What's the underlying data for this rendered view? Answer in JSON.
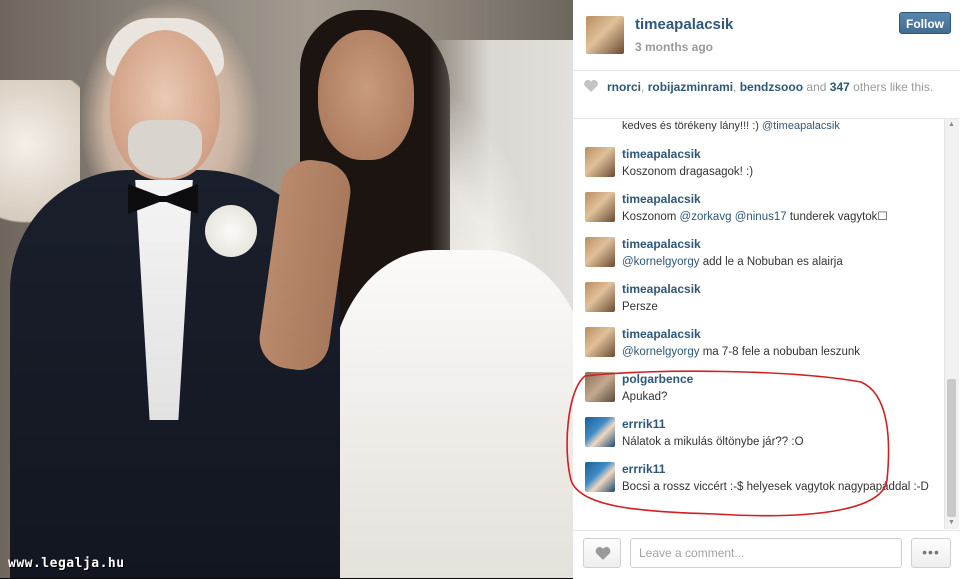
{
  "watermark": "www.legalja.hu",
  "post": {
    "username": "timeapalacsik",
    "time": "3 months ago",
    "follow_label": "Follow"
  },
  "likes": {
    "users": [
      "rnorci",
      "robijazminrami",
      "bendzsooo"
    ],
    "and": "and",
    "count": "347",
    "rest": "others like this."
  },
  "cut_comment": {
    "text": "kedves és törékeny lány!!! :)",
    "mention": "@timeapalacsik"
  },
  "comments": [
    {
      "user": "timeapalacsik",
      "parts": [
        {
          "t": "Koszonom dragasagok! :)"
        }
      ]
    },
    {
      "user": "timeapalacsik",
      "parts": [
        {
          "t": "Koszonom "
        },
        {
          "m": "@zorkavg"
        },
        {
          "t": " "
        },
        {
          "m": "@ninus17"
        },
        {
          "t": " tunderek vagytok☐"
        }
      ]
    },
    {
      "user": "timeapalacsik",
      "parts": [
        {
          "m": "@kornelgyorgy"
        },
        {
          "t": " add le a Nobuban es alairja"
        }
      ]
    },
    {
      "user": "timeapalacsik",
      "parts": [
        {
          "t": "Persze"
        }
      ]
    },
    {
      "user": "timeapalacsik",
      "parts": [
        {
          "m": "@kornelgyorgy"
        },
        {
          "t": " ma 7-8 fele a nobuban leszunk"
        }
      ]
    },
    {
      "user": "polgarbence",
      "parts": [
        {
          "t": "Apukad?"
        }
      ]
    },
    {
      "user": "errrik11",
      "parts": [
        {
          "t": "Nálatok a mikulás öltönybe jár?? :O"
        }
      ]
    },
    {
      "user": "errrik11",
      "parts": [
        {
          "t": "Bocsi a rossz viccért :-$ helyesek vagytok nagypapáddal :-D"
        }
      ]
    }
  ],
  "comment_box": {
    "placeholder": "Leave a comment...",
    "more_label": "•••"
  },
  "colors": {
    "link": "#2f5777",
    "follow_bg": "#3f6d94",
    "annotation": "#d21f1f"
  },
  "icons": [
    "heart-icon",
    "ellipsis-icon"
  ]
}
